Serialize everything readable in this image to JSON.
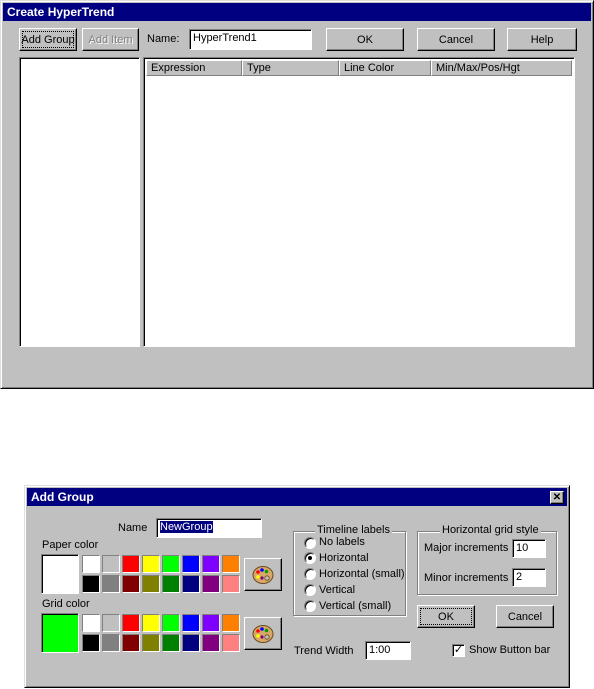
{
  "create_window": {
    "title": "Create HyperTrend",
    "add_group_label": "Add Group",
    "add_item_label": "Add Item",
    "name_label": "Name:",
    "name_value": "HyperTrend1",
    "ok_label": "OK",
    "cancel_label": "Cancel",
    "help_label": "Help",
    "columns": [
      "Expression",
      "Type",
      "Line Color",
      "Min/Max/Pos/Hgt"
    ]
  },
  "add_group_dialog": {
    "title": "Add Group",
    "close_icon": "close-icon",
    "name_label": "Name",
    "name_value": "NewGroup",
    "paper_color_label": "Paper color",
    "grid_color_label": "Grid color",
    "paper_color_selected": "#ffffff",
    "grid_color_selected": "#00ff00",
    "palette_top": [
      "#ffffff",
      "#c0c0c0",
      "#ff0000",
      "#ffff00",
      "#00ff00",
      "#0000ff",
      "#8000ff",
      "#ff8000"
    ],
    "palette_bottom": [
      "#000000",
      "#808080",
      "#800000",
      "#808000",
      "#008000",
      "#000080",
      "#800080",
      "#ff8080"
    ],
    "palette_icon": "palette-icon",
    "timeline_labels": {
      "title": "Timeline labels",
      "options": [
        "No labels",
        "Horizontal",
        "Horizontal (small)",
        "Vertical",
        "Vertical (small)"
      ],
      "selected_index": 1
    },
    "grid_style": {
      "title": "Horizontal grid style",
      "major_label": "Major increments",
      "major_value": "10",
      "minor_label": "Minor increments",
      "minor_value": "2"
    },
    "ok_label": "OK",
    "cancel_label": "Cancel",
    "trend_width_label": "Trend Width",
    "trend_width_value": "1:00",
    "show_button_bar_label": "Show Button bar",
    "show_button_bar_checked": true
  }
}
